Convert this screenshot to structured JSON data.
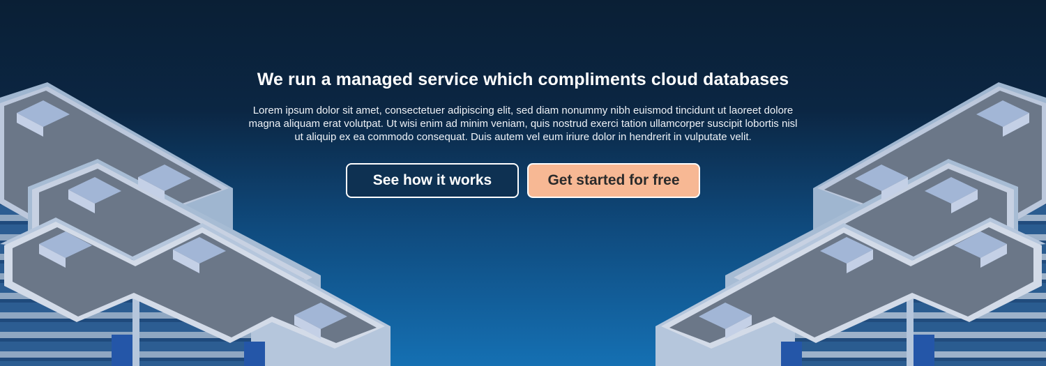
{
  "hero": {
    "title": "We run a managed service which compliments cloud databases",
    "body": "Lorem ipsum dolor sit amet, consectetuer adipiscing elit, sed diam nonummy nibh euismod tincidunt ut laoreet dolore magna aliquam erat volutpat. Ut wisi enim ad minim veniam, quis nostrud exerci tation ullamcorper suscipit lobortis nisl ut aliquip ex ea commodo consequat. Duis autem vel eum iriure dolor in hendrerit in vulputate velit."
  },
  "actions": {
    "secondary_label": "See how it works",
    "primary_label": "Get started for free"
  },
  "colors": {
    "primary_button_bg": "#f7b894",
    "secondary_button_bg": "#0e3152",
    "background_top": "#0a1f35",
    "background_bottom": "#1570b3"
  },
  "illustration": {
    "left": "isometric-buildings",
    "right": "isometric-buildings"
  }
}
